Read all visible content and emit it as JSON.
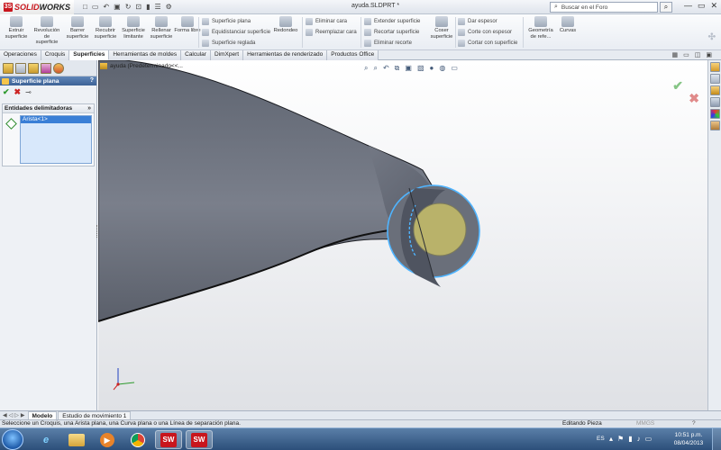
{
  "app": {
    "logo_prefix": "3S",
    "logo_text_1": "SOLID",
    "logo_text_2": "WORKS",
    "document_title": "ayuda.SLDPRT *",
    "search_placeholder": "Buscar en el Foro",
    "window_controls": [
      "—",
      "▭",
      "✕"
    ]
  },
  "quick_access": [
    "□",
    "▭",
    "↶",
    "▣",
    "↻",
    "⊡",
    "▮",
    "☰",
    "⚙"
  ],
  "ribbon": {
    "large_buttons": [
      {
        "label": "Extruir superficie",
        "icon": "extrude-surface-icon"
      },
      {
        "label": "Revolución de superficie",
        "icon": "revolve-surface-icon"
      },
      {
        "label": "Barrer superficie",
        "icon": "sweep-surface-icon"
      },
      {
        "label": "Recubrir superficie",
        "icon": "loft-surface-icon"
      },
      {
        "label": "Superficie limitante",
        "icon": "boundary-surface-icon"
      },
      {
        "label": "Rellenar superficie",
        "icon": "fill-surface-icon"
      },
      {
        "label": "Forma libre",
        "icon": "freeform-icon"
      }
    ],
    "group_a": [
      "Superficie plana",
      "Equidistanciar superficie",
      "Superficie reglada"
    ],
    "radius_button": "Redondeo",
    "group_b": [
      "Eliminar cara",
      "Reemplazar cara"
    ],
    "group_c": [
      "Extender superficie",
      "Recortar superficie",
      "Eliminar recorte"
    ],
    "knit_button": "Coser superficie",
    "group_d": [
      "Dar espesor",
      "Corte con espesor",
      "Cortar con superficie"
    ],
    "reference_button": "Geometría de refe...",
    "curves_button": "Curvas"
  },
  "tabs": [
    {
      "label": "Operaciones",
      "active": false
    },
    {
      "label": "Croquis",
      "active": false
    },
    {
      "label": "Superficies",
      "active": true
    },
    {
      "label": "Herramientas de moldes",
      "active": false
    },
    {
      "label": "Calcular",
      "active": false
    },
    {
      "label": "DimXpert",
      "active": false
    },
    {
      "label": "Herramientas de renderizado",
      "active": false
    },
    {
      "label": "Productos Office",
      "active": false
    }
  ],
  "property_manager": {
    "title": "Superficie plana",
    "help": "?",
    "ok": "✔",
    "cancel": "✖",
    "pin": "⊸",
    "group_title": "Entidades delimitadoras",
    "group_chevron": "»",
    "selections": [
      "Arista<1>"
    ]
  },
  "viewport": {
    "breadcrumb": "ayuda  (Predeterminado<<..."
  },
  "model_tabs": [
    {
      "label": "Modelo",
      "active": true
    },
    {
      "label": "Estudio de movimiento 1",
      "active": false
    }
  ],
  "status": {
    "message": "Seleccione un Croquis, una Arista plana, una Curva plana o una Línea de separación plana.",
    "mode": "Editando Pieza",
    "units": "MMGS",
    "help": "?"
  },
  "taskbar": {
    "language": "ES",
    "time": "10:51 p.m.",
    "date": "08/04/2013"
  },
  "colors": {
    "accent": "#3d6296",
    "part_body": "#6f7480",
    "planar_face": "#b9b26a",
    "selection_edge": "#4fb4ff",
    "ok_green": "#2f9a2f",
    "cancel_red": "#c22222"
  }
}
